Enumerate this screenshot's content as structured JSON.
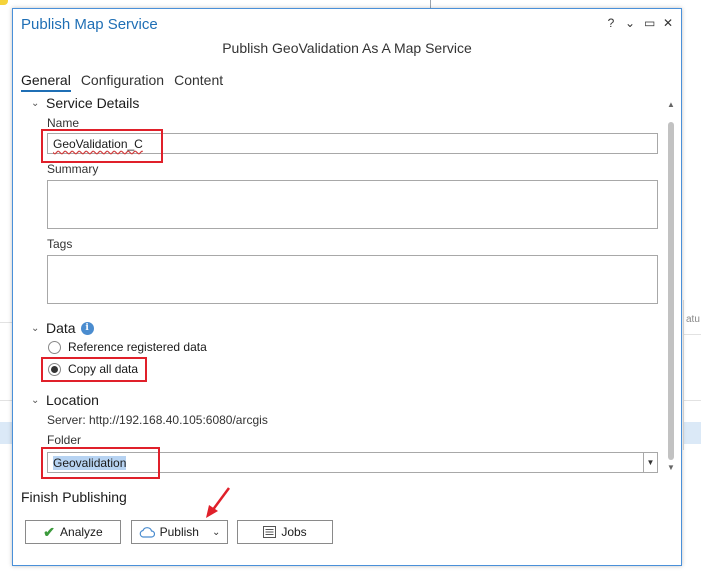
{
  "dialog": {
    "title": "Publish Map Service",
    "subtitle": "Publish GeoValidation As A Map Service",
    "controls": [
      "?",
      "⌄",
      "▭",
      "✕"
    ]
  },
  "tabs": [
    {
      "label": "General",
      "active": true
    },
    {
      "label": "Configuration",
      "active": false
    },
    {
      "label": "Content",
      "active": false
    }
  ],
  "service_details": {
    "heading": "Service Details",
    "name_label": "Name",
    "name_value": "GeoValidation_C",
    "summary_label": "Summary",
    "summary_value": "",
    "tags_label": "Tags",
    "tags_value": ""
  },
  "data_section": {
    "heading": "Data",
    "options": [
      {
        "label": "Reference registered data",
        "checked": false
      },
      {
        "label": "Copy all data",
        "checked": true
      }
    ]
  },
  "location": {
    "heading": "Location",
    "server": "Server: http://192.168.40.105:6080/arcgis",
    "folder_label": "Folder",
    "folder_value": "Geovalidation"
  },
  "finish": {
    "heading": "Finish Publishing",
    "analyze_label": "Analyze",
    "publish_label": "Publish",
    "jobs_label": "Jobs"
  },
  "background": {
    "right_edge_text": "atu"
  },
  "colors": {
    "accent": "#1f6fb5",
    "highlight_box": "#e0202a",
    "selection": "#b7d3f2"
  }
}
